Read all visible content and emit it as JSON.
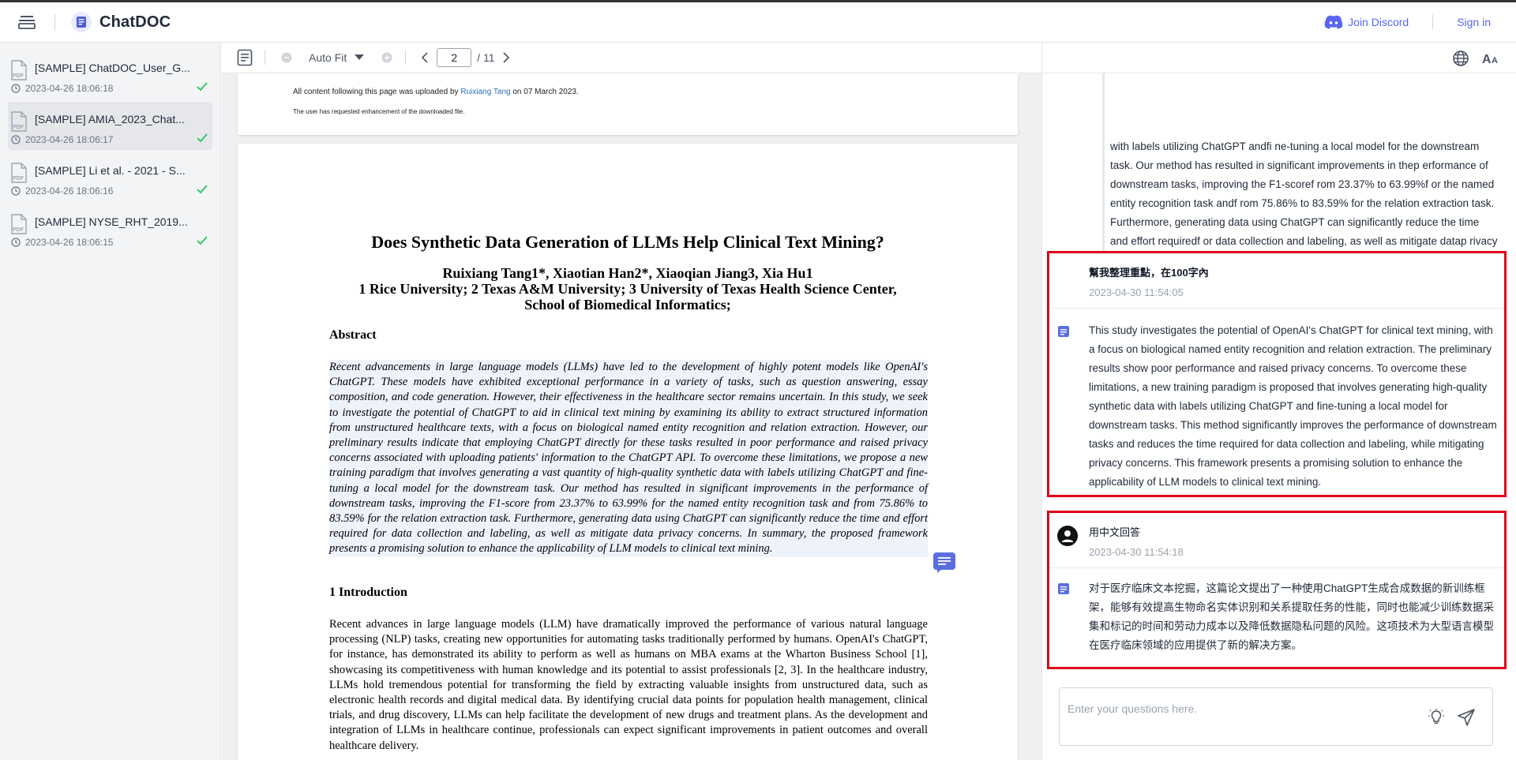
{
  "header": {
    "title": "ChatDOC",
    "discord_label": "Join Discord",
    "signin_label": "Sign in",
    "brand_color": "#5865f2"
  },
  "sidebar": {
    "documents": [
      {
        "name": "[SAMPLE] ChatDOC_User_G...",
        "time": "2023-04-26 18:06:18",
        "active": false
      },
      {
        "name": "[SAMPLE] AMIA_2023_Chat...",
        "time": "2023-04-26 18:06:17",
        "active": true
      },
      {
        "name": "[SAMPLE] Li et al. - 2021 - S...",
        "time": "2023-04-26 18:06:16",
        "active": false
      },
      {
        "name": "[SAMPLE] NYSE_RHT_2019...",
        "time": "2023-04-26 18:06:15",
        "active": false
      }
    ],
    "icons": {
      "file": "pdf-file-icon",
      "clock": "clock-icon",
      "status": "checkmark-icon"
    }
  },
  "viewer": {
    "zoom_label": "Auto Fit",
    "current_page": "2",
    "total_pages": "/ 11",
    "upload_prefix": "All content following this page was uploaded by",
    "upload_author": "Ruixiang Tang",
    "upload_suffix": "on 07 March 2023.",
    "enhancement_note": "The user has requested enhancement of the downloaded file.",
    "paper": {
      "title": "Does Synthetic Data Generation of LLMs Help Clinical Text Mining?",
      "authors_line": "Ruixiang Tang1*, Xiaotian Han2*, Xiaoqian Jiang3, Xia Hu1",
      "affiliation_line1": "1 Rice University; 2 Texas A&M University; 3 University of Texas Health Science Center,",
      "affiliation_line2": "School of Biomedical Informatics;",
      "abstract_heading": "Abstract",
      "abstract": "Recent advancements in large language models (LLMs) have led to the development of highly potent models like OpenAI's ChatGPT. These models have exhibited exceptional performance in a variety of tasks, such as question answering, essay composition, and code generation. However, their effectiveness in the healthcare sector remains uncertain. In this study, we seek to investigate the potential of ChatGPT to aid in clinical text mining by examining its ability to extract structured information from unstructured healthcare texts, with a focus on biological named entity recognition and relation extraction. However, our preliminary results indicate that employing ChatGPT directly for these tasks resulted in poor performance and raised privacy concerns associated with uploading patients' information to the ChatGPT API. To overcome these limitations, we propose a new training paradigm that involves generating a vast quantity of high-quality synthetic data with labels utilizing ChatGPT and fine-tuning a local model for the downstream task. Our method has resulted in significant improvements in the performance of downstream tasks, improving the F1-score from 23.37% to 63.99% for the named entity recognition task and from 75.86% to 83.59% for the relation extraction task. Furthermore, generating data using ChatGPT can significantly reduce the time and effort required for data collection and labeling, as well as mitigate data privacy concerns. In summary, the proposed framework presents a promising solution to enhance the applicability of LLM models to clinical text mining.",
      "intro_heading": "1   Introduction",
      "intro": "Recent advances in large language models (LLM) have dramatically improved the performance of various natural language processing (NLP) tasks, creating new opportunities for automating tasks traditionally performed by humans. OpenAI's ChatGPT, for instance, has demonstrated its ability to perform as well as humans on MBA exams at the Wharton Business School [1], showcasing its competitiveness with human knowledge and its potential to assist professionals [2, 3]. In the healthcare industry, LLMs hold tremendous potential for transforming the field by extracting valuable insights from unstructured data, such as electronic health records and digital medical data. By identifying crucial data points for population health management, clinical trials, and drug discovery, LLMs can help facilitate the development of new drugs and treatment plans. As the development and integration of LLMs in healthcare continue, professionals can expect significant improvements in patient outcomes and overall healthcare delivery."
    }
  },
  "chat": {
    "previous_answer_tail": "with labels utilizing ChatGPT andfi ne-tuning a local model for the downstream task. Our method has resulted in significant improvements in thep erformance of downstream tasks, improving the F1-scoref rom 23.37% to 63.99%f or the named entity recognition task andf rom 75.86% to 83.59% for the relation extraction task. Furthermore, generating data using ChatGPT can significantly reduce the time and effort requiredf or data collection and labeling, as well as mitigate datap rivacy concerns. In summary, thep roposed frameworkp resents ap romising solution to enhance the applicability ofL LM models to clinical text mining.",
    "exchanges": [
      {
        "question": "幫我整理重點，在100字內",
        "time": "2023-04-30 11:54:05",
        "answer": "This study investigates the potential of OpenAI's ChatGPT for clinical text mining, with a focus on biological named entity recognition and relation extraction. The preliminary results show poor performance and raised privacy concerns. To overcome these limitations, a new training paradigm is proposed that involves generating high-quality synthetic data with labels utilizing ChatGPT and fine-tuning a local model for downstream tasks. This method significantly improves the performance of downstream tasks and reduces the time required for data collection and labeling, while mitigating privacy concerns. This framework presents a promising solution to enhance the applicability of LLM models to clinical text mining."
      },
      {
        "question": "用中文回答",
        "time": "2023-04-30 11:54:18",
        "answer": "对于医疗临床文本挖掘，这篇论文提出了一种使用ChatGPT生成合成数据的新训练框架，能够有效提高生物命名实体识别和关系提取任务的性能，同时也能减少训练数据采集和标记的时间和劳动力成本以及降低数据隐私问题的风险。这项技术为大型语言模型在医疗临床领域的应用提供了新的解决方案。"
      }
    ],
    "input_placeholder": "Enter your questions here.",
    "highlight_color": "#e0001b"
  }
}
